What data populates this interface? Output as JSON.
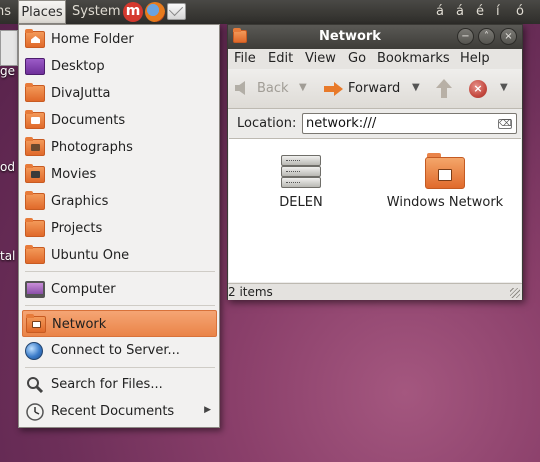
{
  "top_panel": {
    "applications_fragment": "ns",
    "places": "Places",
    "system": "System",
    "launchers": [
      {
        "name": "m-icon",
        "glyph": "m"
      },
      {
        "name": "firefox-icon",
        "glyph": ""
      },
      {
        "name": "mail-icon",
        "glyph": ""
      }
    ],
    "keyboard_layout": " ",
    "char_buttons": [
      "á",
      "á",
      "é",
      "í",
      "ó"
    ]
  },
  "desktop": {
    "fragments": [
      "ge",
      "od",
      "tal"
    ]
  },
  "places_menu": {
    "items": [
      {
        "label": "Home Folder",
        "icon": "home-folder-icon"
      },
      {
        "label": "Desktop",
        "icon": "desktop-folder-icon"
      },
      {
        "label": "DivaJutta",
        "icon": "folder-icon"
      },
      {
        "label": "Documents",
        "icon": "documents-folder-icon"
      },
      {
        "label": "Photographs",
        "icon": "pictures-folder-icon"
      },
      {
        "label": "Movies",
        "icon": "videos-folder-icon"
      },
      {
        "label": "Graphics",
        "icon": "folder-icon"
      },
      {
        "label": "Projects",
        "icon": "folder-icon"
      },
      {
        "label": "Ubuntu One",
        "icon": "folder-icon"
      },
      {
        "label": "Computer",
        "icon": "computer-icon"
      },
      {
        "label": "Network",
        "icon": "network-folder-icon",
        "active": true
      },
      {
        "label": "Connect to Server...",
        "icon": "globe-icon"
      },
      {
        "label": "Search for Files...",
        "icon": "magnifier-icon"
      },
      {
        "label": "Recent Documents",
        "icon": "clock-icon",
        "submenu": "▶"
      }
    ],
    "colors": {
      "highlight": "#ea8448",
      "folder": "#e97535"
    }
  },
  "window": {
    "title": "Network",
    "controls": {
      "minimize": "−",
      "maximize": "˄",
      "close": "×"
    },
    "menubar": [
      "File",
      "Edit",
      "View",
      "Go",
      "Bookmarks",
      "Help"
    ],
    "toolbar": {
      "back": "Back",
      "forward": "Forward",
      "dropdown": "▼",
      "stop": "×"
    },
    "location": {
      "label": "Location:",
      "value": "network:///",
      "clear": "⌫"
    },
    "items": [
      {
        "label": "DELEN",
        "icon": "server-icon"
      },
      {
        "label": "Windows Network",
        "icon": "windows-network-folder-icon"
      }
    ],
    "status": "2 items"
  }
}
